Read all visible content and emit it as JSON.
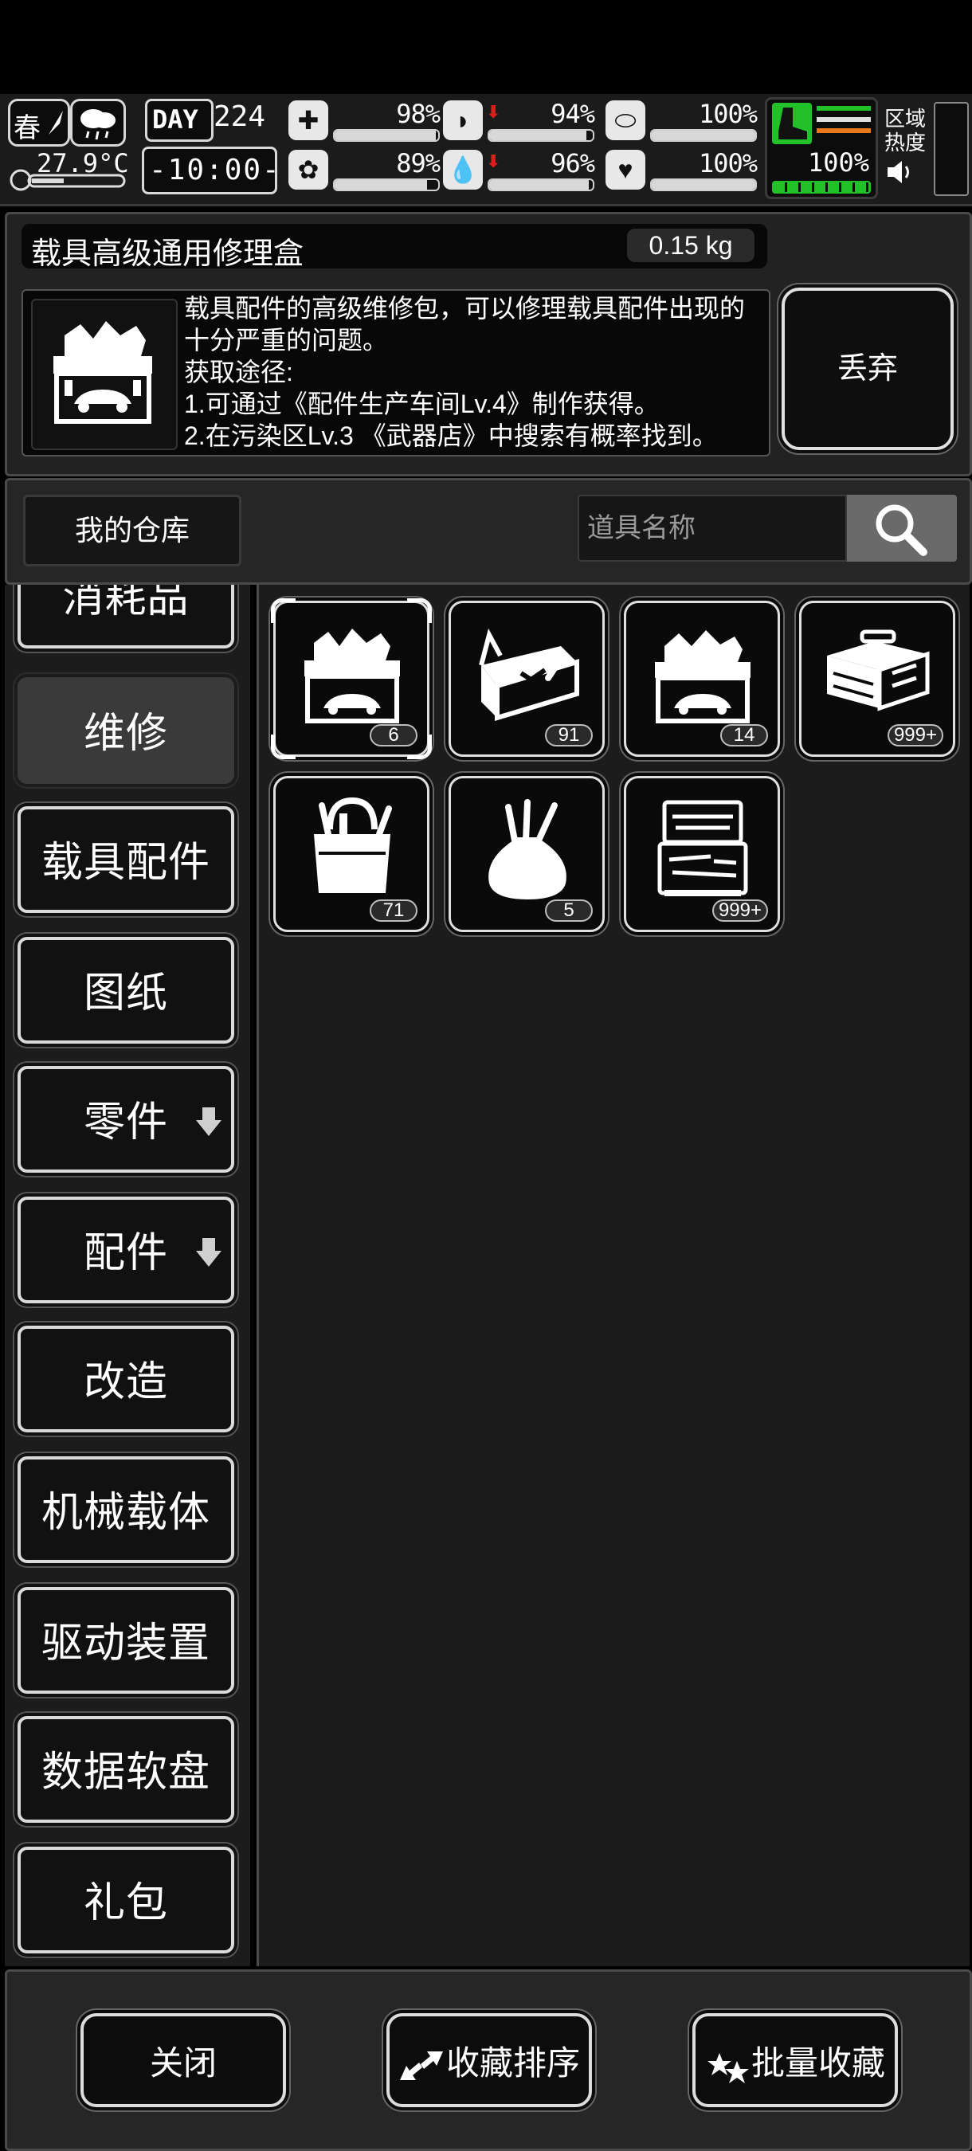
{
  "status": {
    "season": "春",
    "temperature": "27.9°C",
    "day_label": "DAY",
    "day_number": "224",
    "time": "-10:00-",
    "stats_row1": [
      {
        "icon": "medkit-icon",
        "value": "98%",
        "trend": "",
        "level": 0.98
      },
      {
        "icon": "stomach-icon",
        "value": "94%",
        "trend": "down",
        "level": 0.94
      },
      {
        "icon": "capsule-icon",
        "value": "100%",
        "trend": "",
        "level": 1.0
      }
    ],
    "stats_row2": [
      {
        "icon": "brain-icon",
        "value": "89%",
        "trend": "down",
        "level": 0.89
      },
      {
        "icon": "water-drop-icon",
        "value": "96%",
        "trend": "down",
        "level": 0.96
      },
      {
        "icon": "heart-icon",
        "value": "100%",
        "trend": "",
        "level": 1.0
      }
    ],
    "stamina": "100%",
    "region_heat_label_1": "区域",
    "region_heat_label_2": "热度"
  },
  "item": {
    "name": "载具高级通用修理盒",
    "weight": "0.15 kg",
    "description": "载具配件的高级维修包，可以修理载具配件出现的十分严重的问题。\n获取途径:\n1.可通过《配件生产车间Lv.4》制作获得。\n2.在污染区Lv.3 《武器店》中搜索有概率找到。",
    "discard_label": "丢弃"
  },
  "warehouse": {
    "tab_label": "我的仓库",
    "search_placeholder": "道具名称"
  },
  "categories": [
    {
      "label": "消耗品",
      "active": false,
      "arrow": false
    },
    {
      "label": "维修",
      "active": true,
      "arrow": false
    },
    {
      "label": "载具配件",
      "active": false,
      "arrow": false
    },
    {
      "label": "图纸",
      "active": false,
      "arrow": false
    },
    {
      "label": "零件",
      "active": false,
      "arrow": true
    },
    {
      "label": "配件",
      "active": false,
      "arrow": true
    },
    {
      "label": "改造",
      "active": false,
      "arrow": false
    },
    {
      "label": "机械载体",
      "active": false,
      "arrow": false
    },
    {
      "label": "驱动装置",
      "active": false,
      "arrow": false
    },
    {
      "label": "数据软盘",
      "active": false,
      "arrow": false
    },
    {
      "label": "礼包",
      "active": false,
      "arrow": false
    }
  ],
  "items": [
    {
      "icon": "advanced-vehicle-repair-box-icon",
      "count": "6",
      "selected": true
    },
    {
      "icon": "tool-tray-icon",
      "count": "91",
      "selected": false
    },
    {
      "icon": "vehicle-repair-box-icon",
      "count": "14",
      "selected": false
    },
    {
      "icon": "toolbox-icon",
      "count": "999+",
      "selected": false
    },
    {
      "icon": "tool-bag-icon",
      "count": "71",
      "selected": false
    },
    {
      "icon": "tool-pouch-icon",
      "count": "5",
      "selected": false
    },
    {
      "icon": "tool-case-icon",
      "count": "999+",
      "selected": false
    }
  ],
  "bottom": {
    "close_label": "关闭",
    "sort_label": "收藏排序",
    "batch_label": "批量收藏"
  }
}
